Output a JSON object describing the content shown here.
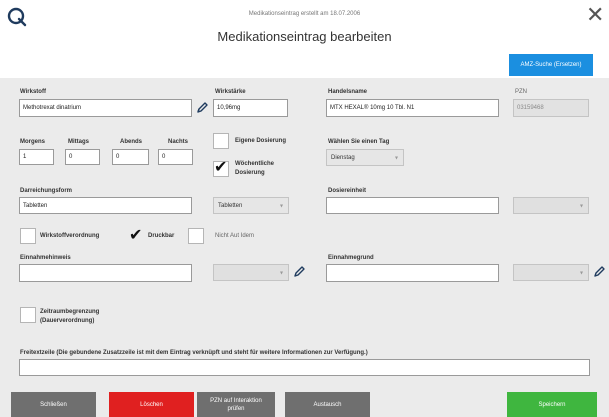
{
  "header": {
    "created_note": "Medikationseintrag erstellt am 18.07.2006",
    "title": "Medikationseintrag bearbeiten",
    "amz_button": "AMZ-Suche (Ersetzen)"
  },
  "wirkstoff": {
    "label": "Wirkstoff",
    "value": "Methotrexat dinatrium"
  },
  "wirkstaerke": {
    "label": "Wirkstärke",
    "value": "10,96mg"
  },
  "handelsname": {
    "label": "Handelsname",
    "value": "MTX HEXAL® 10mg 10 Tbl. N1"
  },
  "pzn": {
    "label": "PZN",
    "value": "03159468"
  },
  "dosierung": {
    "morgens_label": "Morgens",
    "morgens": "1",
    "mittags_label": "Mittags",
    "mittags": "0",
    "abends_label": "Abends",
    "abends": "0",
    "nachts_label": "Nachts",
    "nachts": "0"
  },
  "eigene_dosierung": {
    "label": "Eigene Dosierung",
    "checked": false
  },
  "woechentliche_dosierung": {
    "label": "Wöchentliche Dosierung",
    "checked": true
  },
  "tag": {
    "label": "Wählen Sie einen Tag",
    "value": "Dienstag"
  },
  "darreichungsform": {
    "label": "Darreichungsform",
    "value": "Tabletten",
    "select_value": "Tabletten"
  },
  "dosiereinheit": {
    "label": "Dosiereinheit",
    "value": ""
  },
  "wirkstoffverordnung": {
    "label": "Wirkstoffverordnung",
    "checked": false
  },
  "druckbar": {
    "label": "Druckbar",
    "checked": true
  },
  "nicht_aut_idem": {
    "label": "Nicht Aut Idem",
    "checked": false
  },
  "einnahmehinweis": {
    "label": "Einnahmehinweis",
    "value": ""
  },
  "einnahmegrund": {
    "label": "Einnahmegrund",
    "value": ""
  },
  "zeitraumbegrenzung": {
    "label_line1": "Zeitraumbegrenzung",
    "label_line2": "(Dauerverordnung)",
    "checked": false
  },
  "freitext": {
    "label": "Freitextzeile  (Die gebundene Zusatzzeile ist mit dem Eintrag verknüpft und steht für weitere Informationen zur Verfügung.)",
    "value": ""
  },
  "footer": {
    "schliessen": "Schließen",
    "loeschen": "Löschen",
    "pzn_line1": "PZN auf Interaktion",
    "pzn_line2": "prüfen",
    "austausch": "Austausch",
    "speichern": "Speichern"
  },
  "colors": {
    "accent_blue": "#1b8fe0",
    "delete_red": "#e02020",
    "save_green": "#3fb63f",
    "neutral_button": "#6f6f6f",
    "pencil": "#1f3b5e"
  },
  "icons": [
    "app-logo-icon",
    "close-icon",
    "pencil-icon",
    "checkmark-icon",
    "chevron-down-icon"
  ]
}
